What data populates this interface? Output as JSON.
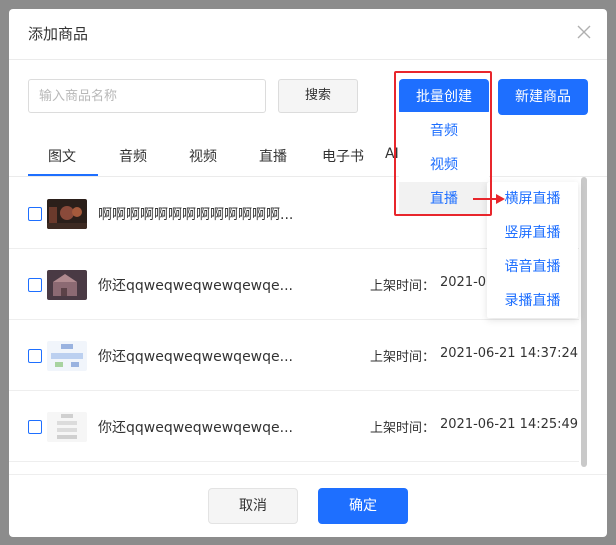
{
  "dialog": {
    "title": "添加商品",
    "close_icon": "close-icon"
  },
  "search": {
    "placeholder": "输入商品名称",
    "value": "",
    "button_label": "搜索"
  },
  "toolbar": {
    "batch_create_label": "批量创建",
    "new_product_label": "新建商品"
  },
  "tabs": [
    {
      "label": "图文",
      "active": true
    },
    {
      "label": "音频"
    },
    {
      "label": "视频"
    },
    {
      "label": "直播"
    },
    {
      "label": "电子书"
    },
    {
      "label": "AI"
    }
  ],
  "dropdown": {
    "items": [
      {
        "label": "音频"
      },
      {
        "label": "视频"
      },
      {
        "label": "直播",
        "active": true
      }
    ]
  },
  "submenu": {
    "items": [
      {
        "label": "横屏直播"
      },
      {
        "label": "竖屏直播"
      },
      {
        "label": "语音直播"
      },
      {
        "label": "录播直播"
      }
    ]
  },
  "products": [
    {
      "name": "啊啊啊啊啊啊啊啊啊啊啊啊啊...",
      "time_label": "",
      "time": "",
      "checked": false
    },
    {
      "name": "你还qqweqweqwewqewqe...",
      "time_label": "上架时间：",
      "time": "2021-0",
      "checked": false
    },
    {
      "name": "你还qqweqweqwewqewqe...",
      "time_label": "上架时间：",
      "time": "2021-06-21 14:37:24",
      "checked": false
    },
    {
      "name": "你还qqweqweqwewqewqe...",
      "time_label": "上架时间：",
      "time": "2021-06-21 14:25:49",
      "checked": false
    }
  ],
  "footer": {
    "cancel_label": "取消",
    "confirm_label": "确定"
  },
  "colors": {
    "primary": "#1e6fff",
    "annotation": "#e8262c",
    "overlay": "#8c8c8c"
  }
}
